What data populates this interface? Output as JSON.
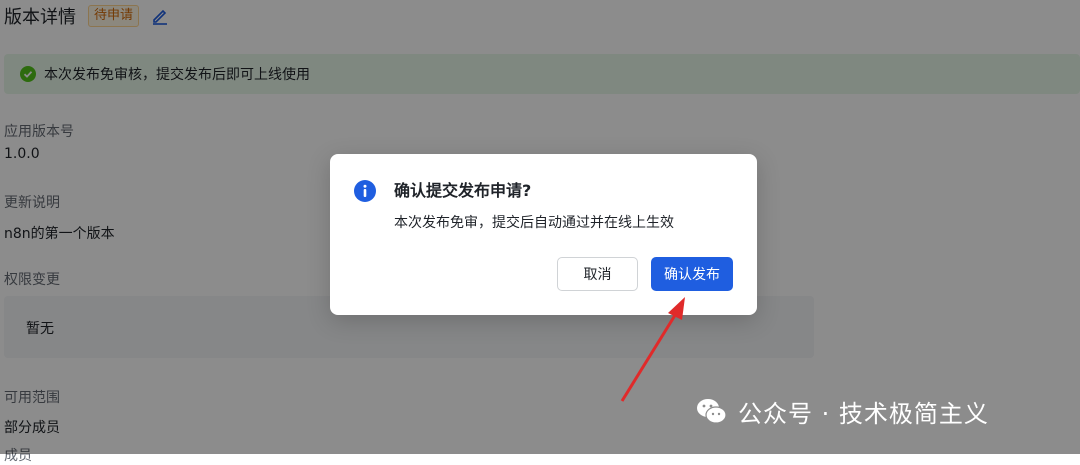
{
  "header": {
    "title": "版本详情",
    "status_tag": "待申请",
    "edit_icon": "edit-icon"
  },
  "alert": {
    "icon": "check-circle-icon",
    "text": "本次发布免审核，提交发布后即可上线使用",
    "color": "#52c41a"
  },
  "fields": {
    "version_label": "应用版本号",
    "version_value": "1.0.0",
    "notes_label": "更新说明",
    "notes_value": "n8n的第一个版本",
    "permissions_label": "权限变更",
    "permissions_value": "暂无",
    "scope_label": "可用范围",
    "scope_value": "部分成员",
    "members_label": "成员"
  },
  "dialog": {
    "icon": "info-icon",
    "title": "确认提交发布申请?",
    "content": "本次发布免审，提交后自动通过并在线上生效",
    "cancel_label": "取消",
    "confirm_label": "确认发布",
    "accent": "#1f5ee0"
  },
  "annotation": {
    "color": "#e02a2a"
  },
  "watermark": {
    "logo": "wechat-icon",
    "text": "公众号 · 技术极简主义"
  }
}
